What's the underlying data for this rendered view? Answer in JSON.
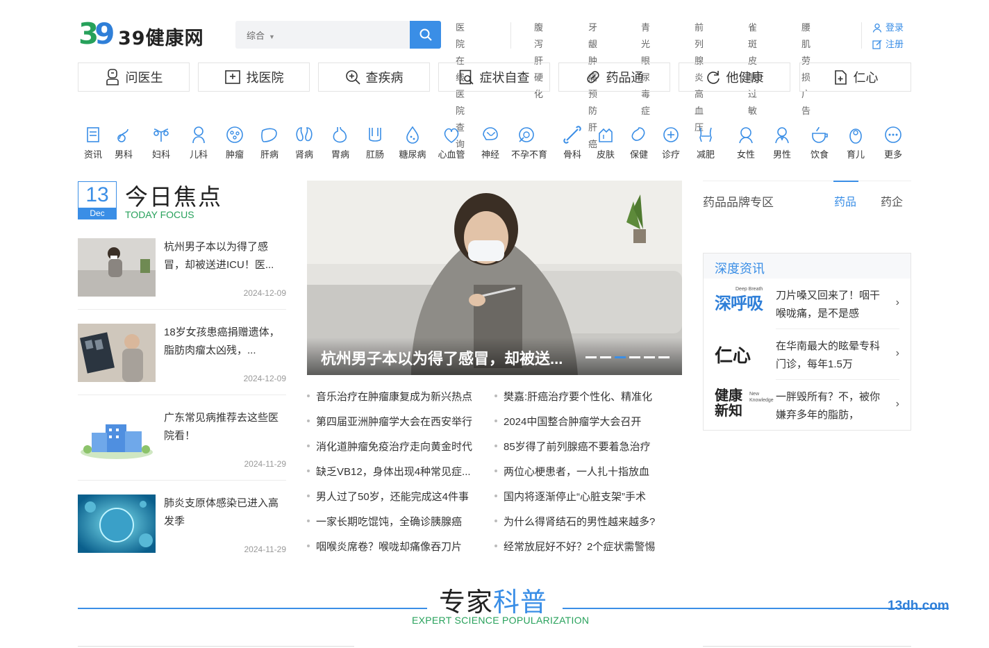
{
  "header": {
    "logo_mark": "39",
    "logo_text": "39健康网",
    "search": {
      "scope": "综合",
      "placeholder": ""
    },
    "quick_links": [
      [
        "医院在线",
        "医院查询"
      ],
      [
        "腹泻",
        "肝硬化"
      ],
      [
        "牙龈肿痛",
        "预防肝癌"
      ],
      [
        "青光眼",
        "尿毒症"
      ],
      [
        "前列腺炎",
        "高血压"
      ],
      [
        "雀斑",
        "皮肤过敏"
      ],
      [
        "腰肌劳损",
        "广告"
      ]
    ],
    "login": "登录",
    "register": "注册"
  },
  "main_nav": [
    "问医生",
    "找医院",
    "查疾病",
    "症状自查",
    "药品通",
    "他健康",
    "仁心"
  ],
  "categories": [
    "资讯",
    "男科",
    "妇科",
    "儿科",
    "肿瘤",
    "肝病",
    "肾病",
    "胃病",
    "肛肠",
    "糖尿病",
    "心血管",
    "神经",
    "不孕不育",
    "骨科",
    "皮肤",
    "保健",
    "诊疗",
    "减肥",
    "女性",
    "男性",
    "饮食",
    "育儿",
    "更多"
  ],
  "focus": {
    "day": "13",
    "month": "Dec",
    "title": "今日焦点",
    "subtitle": "TODAY FOCUS",
    "items": [
      {
        "title": "杭州男子本以为得了感冒，却被送进ICU！医...",
        "date": "2024-12-09"
      },
      {
        "title": "18岁女孩患癌捐赠遗体，脂肪肉瘤太凶残，...",
        "date": "2024-12-09"
      },
      {
        "title": "广东常见病推荐去这些医院看！",
        "date": "2024-11-29"
      },
      {
        "title": "肺炎支原体感染已进入高发季",
        "date": "2024-11-29"
      }
    ]
  },
  "hero": {
    "caption": "杭州男子本以为得了感冒，却被送...",
    "slides": 6,
    "active": 3
  },
  "headlines": {
    "left": [
      "音乐治疗在肿瘤康复成为新兴热点",
      "第四届亚洲肿瘤学大会在西安举行",
      "消化道肿瘤免疫治疗走向黄金时代",
      "缺乏VB12，身体出现4种常见症...",
      "男人过了50岁，还能完成这4件事",
      "一家长期吃馄饨，全确诊胰腺癌",
      "咽喉炎席卷？喉咙却痛像吞刀片"
    ],
    "right": [
      "樊嘉:肝癌治疗要个性化、精准化",
      "2024中国整合肿瘤学大会召开",
      "85岁得了前列腺癌不要着急治疗",
      "两位心梗患者，一人扎十指放血",
      "国内将逐渐停止“心脏支架”手术",
      "为什么得肾结石的男性越来越多?",
      "经常放屁好不好？2个症状需警惕"
    ]
  },
  "right": {
    "brand_label": "药品品牌专区",
    "tab_drug": "药品",
    "tab_company": "药企",
    "deep_title": "深度资讯",
    "deep_items": [
      {
        "logo": "深呼吸",
        "logo_sub": "Deep Breath",
        "text": "刀片嗓又回来了！咽干喉咙痛，是不是感"
      },
      {
        "logo": "仁心",
        "logo_sub": "",
        "text": "在华南最大的眩晕专科门诊，每年1.5万"
      },
      {
        "logo": "健康新知",
        "logo_sub": "New Knowledge",
        "text": "一胖毁所有？不，被你嫌弃多年的脂肪，"
      }
    ],
    "arrow": "›"
  },
  "expert": {
    "title_a": "专家",
    "title_b": "科普",
    "subtitle": "EXPERT SCIENCE POPULARIZATION"
  },
  "watermark": "13dh.com",
  "colors": {
    "accent": "#3a8ee6",
    "green": "#27a15b"
  }
}
